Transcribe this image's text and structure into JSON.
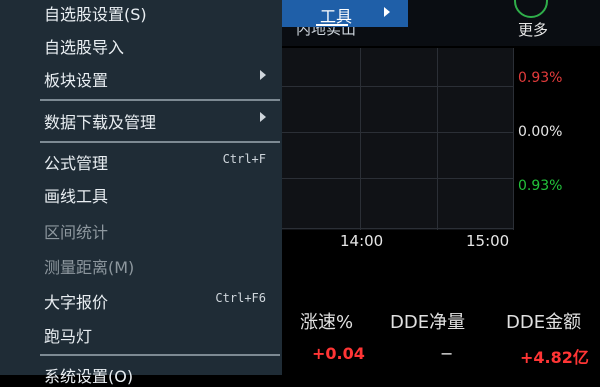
{
  "menu": {
    "items": [
      {
        "label": "自选股设置(S)",
        "shortcut": "",
        "submenu": false,
        "disabled": false
      },
      {
        "label": "自选股导入",
        "shortcut": "",
        "submenu": false,
        "disabled": false
      },
      {
        "label": "板块设置",
        "shortcut": "",
        "submenu": true,
        "disabled": false
      },
      {
        "label": "数据下载及管理",
        "shortcut": "",
        "submenu": true,
        "disabled": false
      },
      {
        "label": "公式管理",
        "shortcut": "Ctrl+F",
        "submenu": false,
        "disabled": false
      },
      {
        "label": "画线工具",
        "shortcut": "",
        "submenu": false,
        "disabled": false
      },
      {
        "label": "区间统计",
        "shortcut": "",
        "submenu": false,
        "disabled": true
      },
      {
        "label": "测量距离(M)",
        "shortcut": "",
        "submenu": false,
        "disabled": true
      },
      {
        "label": "大字报价",
        "shortcut": "Ctrl+F6",
        "submenu": false,
        "disabled": false
      },
      {
        "label": "跑马灯",
        "shortcut": "",
        "submenu": false,
        "disabled": false
      },
      {
        "label": "系统设置(O)",
        "shortcut": "",
        "submenu": false,
        "disabled": false
      }
    ]
  },
  "toolbar": {
    "active_menu": "工具",
    "stock_name": "内地实山",
    "more_label": "更多"
  },
  "chart": {
    "pct_up": "0.93%",
    "pct_zero": "0.00%",
    "pct_down": "0.93%",
    "time_1": "14:00",
    "time_2": "15:00"
  },
  "quote_table": {
    "headers": [
      "涨速%",
      "DDE净量",
      "DDE金额"
    ],
    "values": [
      "+0.04",
      "−",
      "+4.82亿"
    ]
  },
  "colors": {
    "menu_bg": "#1f2c36",
    "highlight": "#1f5fa8",
    "up": "#e23b3b",
    "down": "#22c23a"
  }
}
